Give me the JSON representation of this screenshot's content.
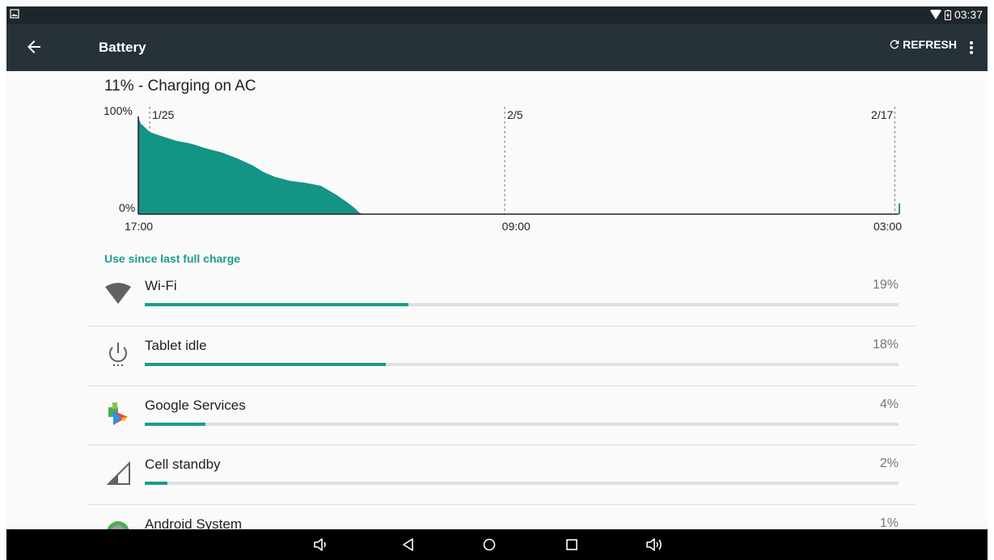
{
  "status_bar": {
    "time": "03:37",
    "icons": [
      "image-icon",
      "wifi-icon",
      "battery-icon"
    ]
  },
  "app_bar": {
    "title": "Battery",
    "refresh_label": "REFRESH",
    "icons": [
      "back-arrow-icon",
      "refresh-icon",
      "overflow-menu-icon"
    ]
  },
  "summary": "11% - Charging on AC",
  "chart_data": {
    "type": "area",
    "y_labels": [
      "100%",
      "0%"
    ],
    "date_labels": [
      "1/25",
      "2/5",
      "2/17"
    ],
    "x_tick_labels": [
      "17:00",
      "09:00",
      "03:00"
    ],
    "ylim": [
      0,
      100
    ],
    "series": [
      {
        "x_fraction": [
          0.0,
          0.003,
          0.015,
          0.03,
          0.05,
          0.07,
          0.09,
          0.11,
          0.13,
          0.15,
          0.165,
          0.18,
          0.2,
          0.22,
          0.24,
          0.26,
          0.275,
          0.285,
          0.29,
          0.295
        ],
        "values": [
          100,
          93,
          84,
          80,
          75,
          72,
          67,
          63,
          57,
          50,
          43,
          38,
          34,
          32,
          29,
          20,
          12,
          6,
          2,
          0
        ]
      }
    ],
    "color": "#139484"
  },
  "section_header": "Use since last full charge",
  "items": [
    {
      "label": "Wi-Fi",
      "percent": "19%",
      "fill": 0.35,
      "icon": "wifi-icon"
    },
    {
      "label": "Tablet idle",
      "percent": "18%",
      "fill": 0.32,
      "icon": "power-icon"
    },
    {
      "label": "Google Services",
      "percent": "4%",
      "fill": 0.08,
      "icon": "google-services-icon"
    },
    {
      "label": "Cell standby",
      "percent": "2%",
      "fill": 0.03,
      "icon": "cell-signal-icon"
    },
    {
      "label": "Android System",
      "percent": "1%",
      "fill": 0.0,
      "icon": "android-icon"
    }
  ],
  "nav_bar": {
    "icons": [
      "volume-down-icon",
      "back-icon",
      "home-icon",
      "recents-icon",
      "volume-up-icon"
    ]
  },
  "colors": {
    "accent": "#1a9c8c",
    "app_bar": "#263238",
    "status_bar": "#1e262a"
  }
}
